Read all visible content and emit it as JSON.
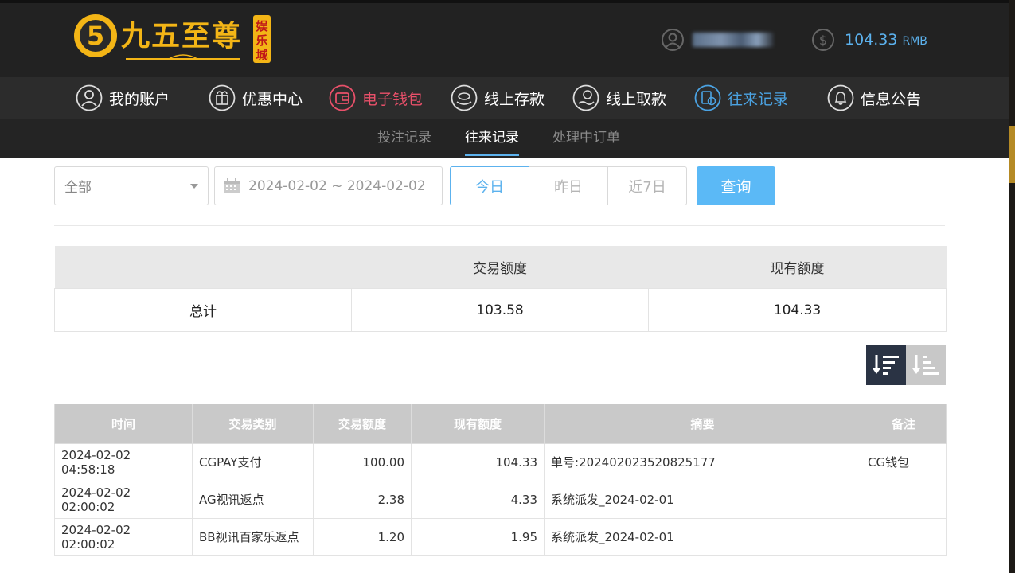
{
  "header": {
    "logo_text": "九五至尊",
    "logo_badge": "娱乐城",
    "balance": "104.33",
    "currency": "RMB"
  },
  "nav": {
    "items": [
      {
        "label": "我的账户",
        "icon": "user-icon"
      },
      {
        "label": "优惠中心",
        "icon": "gift-icon"
      },
      {
        "label": "电子钱包",
        "icon": "wallet-icon",
        "active_color": "#e9506a"
      },
      {
        "label": "线上存款",
        "icon": "deposit-icon"
      },
      {
        "label": "线上取款",
        "icon": "withdraw-icon"
      },
      {
        "label": "往来记录",
        "icon": "records-icon",
        "active_color": "#4ba3e3"
      },
      {
        "label": "信息公告",
        "icon": "bell-icon"
      }
    ]
  },
  "subnav": {
    "items": [
      {
        "label": "投注记录"
      },
      {
        "label": "往来记录",
        "active": true
      },
      {
        "label": "处理中订单"
      }
    ]
  },
  "filter": {
    "type_select": "全部",
    "date_range": "2024-02-02 ~ 2024-02-02",
    "range_buttons": [
      "今日",
      "昨日",
      "近7日"
    ],
    "active_range": "今日",
    "query_label": "查询"
  },
  "summary": {
    "headers": [
      "",
      "交易额度",
      "现有额度"
    ],
    "row": {
      "label": "总计",
      "amount": "103.58",
      "balance": "104.33"
    }
  },
  "records": {
    "headers": [
      "时间",
      "交易类别",
      "交易额度",
      "现有额度",
      "摘要",
      "备注"
    ],
    "rows": [
      {
        "time": "2024-02-02 04:58:18",
        "type": "CGPAY支付",
        "amount": "100.00",
        "balance": "104.33",
        "summary": "单号:202402023520825177",
        "note": "CG钱包"
      },
      {
        "time": "2024-02-02 02:00:02",
        "type": "AG视讯返点",
        "amount": "2.38",
        "balance": "4.33",
        "summary": "系统派发_2024-02-01",
        "note": ""
      },
      {
        "time": "2024-02-02 02:00:02",
        "type": "BB视讯百家乐返点",
        "amount": "1.20",
        "balance": "1.95",
        "summary": "系统派发_2024-02-01",
        "note": ""
      }
    ]
  },
  "colors": {
    "accent_blue": "#5cb2ee",
    "active_red": "#e9506a",
    "header_bg": "#222222",
    "logo_gold": "#f3b516"
  }
}
